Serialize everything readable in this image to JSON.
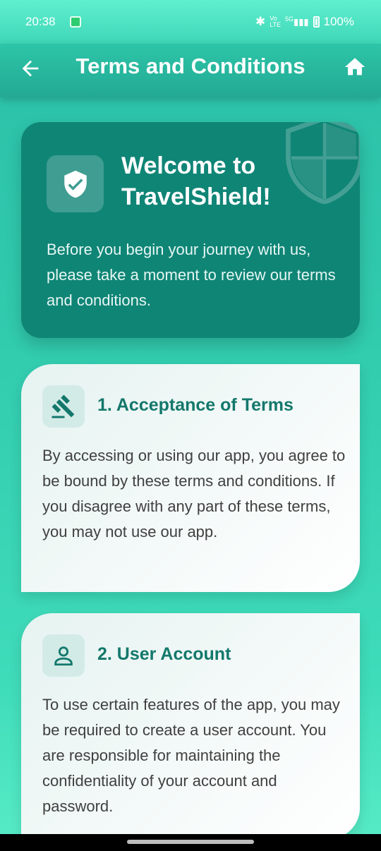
{
  "status_bar": {
    "time": "20:38",
    "signal_label": "5G",
    "battery": "100%"
  },
  "header": {
    "title": "Terms and Conditions",
    "back_icon": "arrow-left-icon",
    "home_icon": "home-icon"
  },
  "welcome": {
    "title": "Welcome to TravelShield!",
    "description": "Before you begin your journey with us, please take a moment to review our terms and conditions.",
    "icon": "shield-check-icon"
  },
  "sections": [
    {
      "title": "1. Acceptance of Terms",
      "icon": "gavel-icon",
      "body": "By accessing or using our app, you agree to be bound by these terms and conditions. If you disagree with any part of these terms, you may not use our app."
    },
    {
      "title": "2. User Account",
      "icon": "person-icon",
      "body": "To use certain features of the app, you may be required to create a user account. You are responsible for maintaining the confidentiality of your account and password."
    }
  ],
  "colors": {
    "primary": "#13786b",
    "header_bg": "#23a994",
    "welcome_card_bg": "#0f8576",
    "background": "#31cbae"
  }
}
